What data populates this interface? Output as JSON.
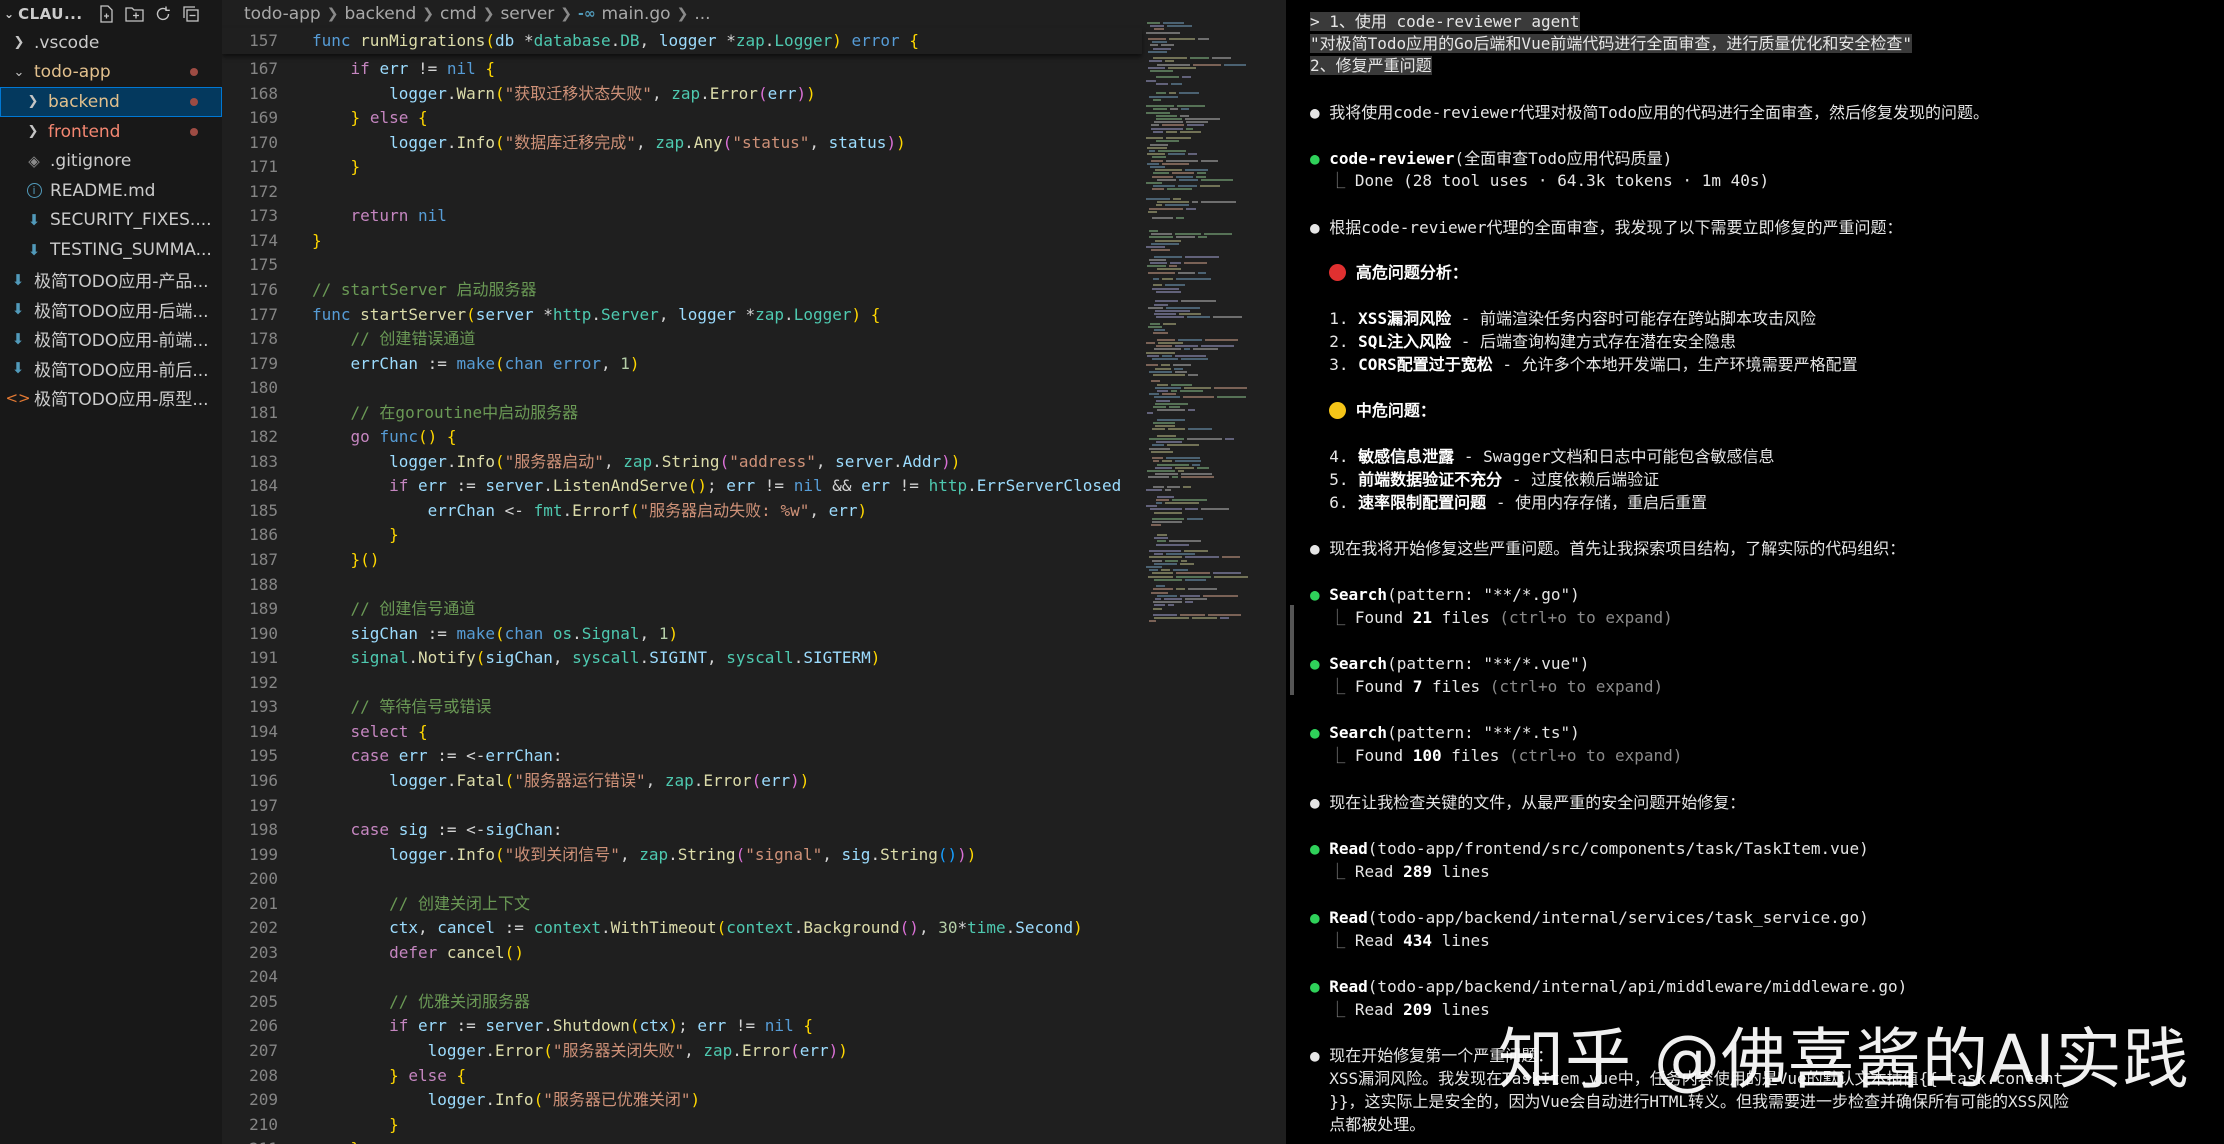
{
  "explorer": {
    "title": "CLAU...",
    "actions": [
      "new-file-icon",
      "new-folder-icon",
      "refresh-icon",
      "collapse-all-icon"
    ],
    "items": [
      {
        "label": ".vscode",
        "kind": "folder",
        "expanded": false,
        "indent": 1
      },
      {
        "label": "todo-app",
        "kind": "folder",
        "expanded": true,
        "indent": 1,
        "status": "modified"
      },
      {
        "label": "backend",
        "kind": "folder",
        "expanded": false,
        "indent": 2,
        "status": "modified",
        "selected": true
      },
      {
        "label": "frontend",
        "kind": "folder",
        "expanded": false,
        "indent": 2,
        "status": "error"
      },
      {
        "label": ".gitignore",
        "kind": "git",
        "indent": 2
      },
      {
        "label": "README.md",
        "kind": "info",
        "indent": 2
      },
      {
        "label": "SECURITY_FIXES....",
        "kind": "md",
        "indent": 2
      },
      {
        "label": "TESTING_SUMMA...",
        "kind": "md",
        "indent": 2
      },
      {
        "label": "极简TODO应用-产品...",
        "kind": "md",
        "indent": 0
      },
      {
        "label": "极简TODO应用-后端...",
        "kind": "md",
        "indent": 0
      },
      {
        "label": "极简TODO应用-前端...",
        "kind": "md",
        "indent": 0
      },
      {
        "label": "极简TODO应用-前后...",
        "kind": "md",
        "indent": 0
      },
      {
        "label": "极简TODO应用-原型...",
        "kind": "html",
        "indent": 0
      }
    ]
  },
  "editor": {
    "breadcrumb": [
      "todo-app",
      "backend",
      "cmd",
      "server",
      "main.go",
      "..."
    ],
    "sticky": {
      "line": 157,
      "code": "func runMigrations(db *database.DB, logger *zap.Logger) error {"
    },
    "lines": [
      {
        "n": 167,
        "code": "    if err != nil {"
      },
      {
        "n": 168,
        "code": "        logger.Warn(\"获取迁移状态失败\", zap.Error(err))"
      },
      {
        "n": 169,
        "code": "    } else {"
      },
      {
        "n": 170,
        "code": "        logger.Info(\"数据库迁移完成\", zap.Any(\"status\", status))"
      },
      {
        "n": 171,
        "code": "    }"
      },
      {
        "n": 172,
        "code": ""
      },
      {
        "n": 173,
        "code": "    return nil"
      },
      {
        "n": 174,
        "code": "}"
      },
      {
        "n": 175,
        "code": ""
      },
      {
        "n": 176,
        "code": "// startServer 启动服务器"
      },
      {
        "n": 177,
        "code": "func startServer(server *http.Server, logger *zap.Logger) {"
      },
      {
        "n": 178,
        "code": "    // 创建错误通道"
      },
      {
        "n": 179,
        "code": "    errChan := make(chan error, 1)"
      },
      {
        "n": 180,
        "code": ""
      },
      {
        "n": 181,
        "code": "    // 在goroutine中启动服务器"
      },
      {
        "n": 182,
        "code": "    go func() {"
      },
      {
        "n": 183,
        "code": "        logger.Info(\"服务器启动\", zap.String(\"address\", server.Addr))"
      },
      {
        "n": 184,
        "code": "        if err := server.ListenAndServe(); err != nil && err != http.ErrServerClosed"
      },
      {
        "n": 185,
        "code": "            errChan <- fmt.Errorf(\"服务器启动失败: %w\", err)"
      },
      {
        "n": 186,
        "code": "        }"
      },
      {
        "n": 187,
        "code": "    }()"
      },
      {
        "n": 188,
        "code": ""
      },
      {
        "n": 189,
        "code": "    // 创建信号通道"
      },
      {
        "n": 190,
        "code": "    sigChan := make(chan os.Signal, 1)"
      },
      {
        "n": 191,
        "code": "    signal.Notify(sigChan, syscall.SIGINT, syscall.SIGTERM)"
      },
      {
        "n": 192,
        "code": ""
      },
      {
        "n": 193,
        "code": "    // 等待信号或错误"
      },
      {
        "n": 194,
        "code": "    select {"
      },
      {
        "n": 195,
        "code": "    case err := <-errChan:"
      },
      {
        "n": 196,
        "code": "        logger.Fatal(\"服务器运行错误\", zap.Error(err))"
      },
      {
        "n": 197,
        "code": ""
      },
      {
        "n": 198,
        "code": "    case sig := <-sigChan:"
      },
      {
        "n": 199,
        "code": "        logger.Info(\"收到关闭信号\", zap.String(\"signal\", sig.String()))"
      },
      {
        "n": 200,
        "code": ""
      },
      {
        "n": 201,
        "code": "        // 创建关闭上下文"
      },
      {
        "n": 202,
        "code": "        ctx, cancel := context.WithTimeout(context.Background(), 30*time.Second)"
      },
      {
        "n": 203,
        "code": "        defer cancel()"
      },
      {
        "n": 204,
        "code": ""
      },
      {
        "n": 205,
        "code": "        // 优雅关闭服务器"
      },
      {
        "n": 206,
        "code": "        if err := server.Shutdown(ctx); err != nil {"
      },
      {
        "n": 207,
        "code": "            logger.Error(\"服务器关闭失败\", zap.Error(err))"
      },
      {
        "n": 208,
        "code": "        } else {"
      },
      {
        "n": 209,
        "code": "            logger.Info(\"服务器已优雅关闭\")"
      },
      {
        "n": 210,
        "code": "        }"
      },
      {
        "n": 211,
        "code": "    }"
      }
    ]
  },
  "terminal": {
    "prompt": [
      "> 1、使用 code-reviewer agent",
      "\"对极简Todo应用的Go后端和Vue前端代码进行全面审查，进行质量优化和安全检查\"",
      "2、修复严重问题"
    ],
    "intro": "我将使用code-reviewer代理对极简Todo应用的代码进行全面审查，然后修复发现的问题。",
    "agent_call": {
      "name": "code-reviewer",
      "args": "(全面审查Todo应用代码质量)",
      "result": "Done (28 tool uses · 64.3k tokens · 1m 40s)"
    },
    "summary": "根据code-reviewer代理的全面审查，我发现了以下需要立即修复的严重问题：",
    "high_heading": "高危问题分析：",
    "high_items": [
      {
        "num": "1.",
        "title": "XSS漏洞风险",
        "desc": " - 前端渲染任务内容时可能存在跨站脚本攻击风险"
      },
      {
        "num": "2.",
        "title": "SQL注入风险",
        "desc": " - 后端查询构建方式存在潜在安全隐患"
      },
      {
        "num": "3.",
        "title": "CORS配置过于宽松",
        "desc": " - 允许多个本地开发端口，生产环境需要严格配置"
      }
    ],
    "mid_heading": "中危问题：",
    "mid_items": [
      {
        "num": "4.",
        "title": "敏感信息泄露",
        "desc": " - Swagger文档和日志中可能包含敏感信息"
      },
      {
        "num": "5.",
        "title": "前端数据验证不充分",
        "desc": " - 过度依赖后端验证"
      },
      {
        "num": "6.",
        "title": "速率限制配置问题",
        "desc": " - 使用内存存储，重启后重置"
      }
    ],
    "start_fix": "现在我将开始修复这些严重问题。首先让我探索项目结构，了解实际的代码组织：",
    "searches": [
      {
        "tool": "Search",
        "args": "(pattern: \"**/*.go\")",
        "pre": "Found ",
        "count": "21",
        "post": " files",
        "hint": " (ctrl+o to expand)"
      },
      {
        "tool": "Search",
        "args": "(pattern: \"**/*.vue\")",
        "pre": "Found ",
        "count": "7",
        "post": " files",
        "hint": " (ctrl+o to expand)"
      },
      {
        "tool": "Search",
        "args": "(pattern: \"**/*.ts\")",
        "pre": "Found ",
        "count": "100",
        "post": " files",
        "hint": " (ctrl+o to expand)"
      }
    ],
    "check_files": "现在让我检查关键的文件，从最严重的安全问题开始修复：",
    "reads": [
      {
        "tool": "Read",
        "args": "(todo-app/frontend/src/components/task/TaskItem.vue)",
        "pre": "Read ",
        "count": "289",
        "post": " lines"
      },
      {
        "tool": "Read",
        "args": "(todo-app/backend/internal/services/task_service.go)",
        "pre": "Read ",
        "count": "434",
        "post": " lines"
      },
      {
        "tool": "Read",
        "args": "(todo-app/backend/internal/api/middleware/middleware.go)",
        "pre": "Read ",
        "count": "209",
        "post": " lines"
      }
    ],
    "final_lines": [
      "现在开始修复第一个严重问题：",
      "XSS漏洞风险。我发现在TaskItem.vue中，任务内容使用的是Vue的默认文本插值{{ task.content",
      "}}，这实际上是安全的，因为Vue会自动进行HTML转义。但我需要进一步检查并确保所有可能的XSS风险",
      "点都被处理。"
    ]
  },
  "watermark": "知乎 @佛喜酱的AI实践"
}
